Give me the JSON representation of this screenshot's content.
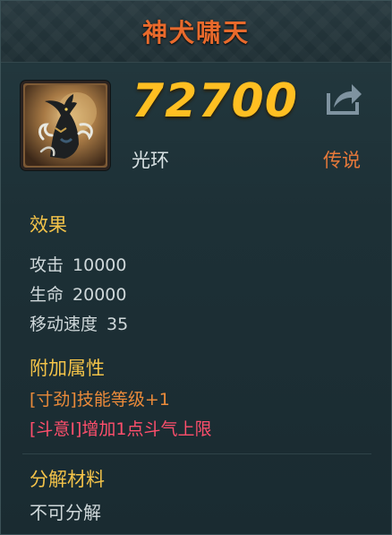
{
  "item": {
    "name": "神犬啸天",
    "price": "72700",
    "category": "光环",
    "rarity": "传说",
    "colors": {
      "name": "#e96a2c",
      "price": "#ffbf22",
      "rarity": "#e7793a",
      "section": "#f3c349",
      "bonus_orange": "#ea8a3a",
      "bonus_pink": "#ff4f6c"
    }
  },
  "effects": {
    "heading": "效果",
    "stats": [
      {
        "label": "攻击",
        "value": "10000"
      },
      {
        "label": "生命",
        "value": "20000"
      },
      {
        "label": "移动速度",
        "value": "35"
      }
    ]
  },
  "extra": {
    "heading": "附加属性",
    "lines": [
      "[寸劲]技能等级+1",
      "[斗意Ⅰ]增加1点斗气上限"
    ]
  },
  "decompose": {
    "heading": "分解材料",
    "text": "不可分解"
  },
  "icons": {
    "share": "share-icon",
    "item": "divine-dog-icon"
  }
}
